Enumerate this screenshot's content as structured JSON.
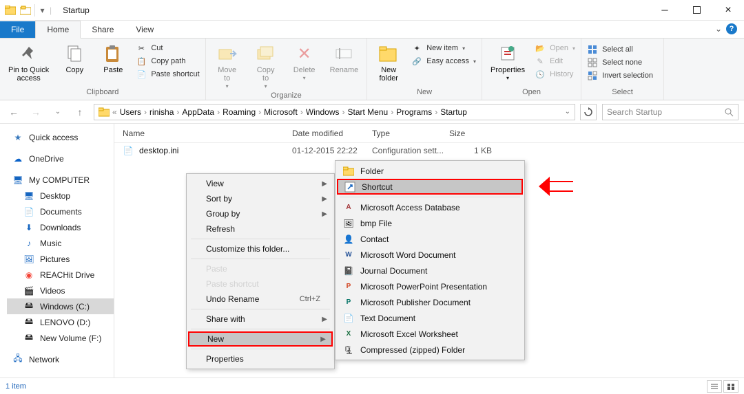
{
  "window": {
    "title": "Startup"
  },
  "tabs": {
    "file": "File",
    "home": "Home",
    "share": "Share",
    "view": "View"
  },
  "ribbon": {
    "pin": "Pin to Quick\naccess",
    "copy": "Copy",
    "paste": "Paste",
    "cut": "Cut",
    "copy_path": "Copy path",
    "paste_shortcut": "Paste shortcut",
    "clipboard_label": "Clipboard",
    "move_to": "Move\nto",
    "copy_to": "Copy\nto",
    "delete": "Delete",
    "rename": "Rename",
    "organize_label": "Organize",
    "new_folder": "New\nfolder",
    "new_item": "New item",
    "easy_access": "Easy access",
    "new_label": "New",
    "properties": "Properties",
    "open": "Open",
    "edit": "Edit",
    "history": "History",
    "open_label": "Open",
    "select_all": "Select all",
    "select_none": "Select none",
    "invert_selection": "Invert selection",
    "select_label": "Select"
  },
  "breadcrumb": [
    "Users",
    "rinisha",
    "AppData",
    "Roaming",
    "Microsoft",
    "Windows",
    "Start Menu",
    "Programs",
    "Startup"
  ],
  "search_placeholder": "Search Startup",
  "sidebar": {
    "quick_access": "Quick access",
    "onedrive": "OneDrive",
    "my_computer": "My COMPUTER",
    "desktop": "Desktop",
    "documents": "Documents",
    "downloads": "Downloads",
    "music": "Music",
    "pictures": "Pictures",
    "reachit": "REACHit Drive",
    "videos": "Videos",
    "windows_c": "Windows (C:)",
    "lenovo_d": "LENOVO (D:)",
    "new_volume_f": "New Volume (F:)",
    "network": "Network"
  },
  "columns": {
    "name": "Name",
    "date": "Date modified",
    "type": "Type",
    "size": "Size"
  },
  "file": {
    "name": "desktop.ini",
    "date": "01-12-2015 22:22",
    "type": "Configuration sett...",
    "size": "1 KB"
  },
  "context_menu": {
    "view": "View",
    "sort_by": "Sort by",
    "group_by": "Group by",
    "refresh": "Refresh",
    "customize": "Customize this folder...",
    "paste": "Paste",
    "paste_shortcut": "Paste shortcut",
    "undo_rename": "Undo Rename",
    "undo_shortcut": "Ctrl+Z",
    "share_with": "Share with",
    "new": "New",
    "properties": "Properties"
  },
  "submenu": {
    "folder": "Folder",
    "shortcut": "Shortcut",
    "access_db": "Microsoft Access Database",
    "bmp": "bmp File",
    "contact": "Contact",
    "word": "Microsoft Word Document",
    "journal": "Journal Document",
    "ppt": "Microsoft PowerPoint Presentation",
    "publisher": "Microsoft Publisher Document",
    "text": "Text Document",
    "excel": "Microsoft Excel Worksheet",
    "zip": "Compressed (zipped) Folder"
  },
  "status": {
    "count": "1 item"
  }
}
